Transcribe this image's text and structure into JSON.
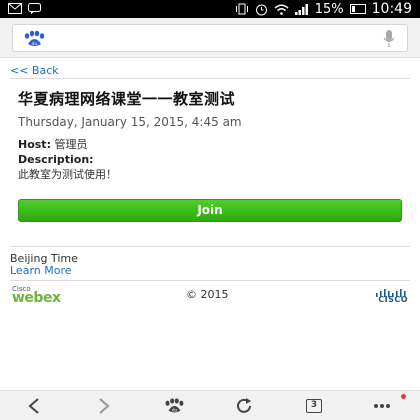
{
  "statusbar": {
    "battery": "15%",
    "time": "10:49"
  },
  "browser": {
    "search_placeholder": ""
  },
  "page": {
    "back_link": "<< Back",
    "title": "华夏病理网络课堂一一教室测试",
    "datetime": "Thursday, January 15, 2015, 4:45 am",
    "host_label": "Host:",
    "host_name": "管理员",
    "description_label": "Description:",
    "description_text": "此教室为测试使用！",
    "join_button": "Join",
    "timezone": "Beijing Time",
    "learn_more": "Learn More"
  },
  "footer": {
    "brand_small": "Cisco",
    "brand": "webex",
    "copyright": "© 2015",
    "cisco_word": "CISCO"
  },
  "navbar": {
    "tab_count": "3"
  },
  "colors": {
    "link": "#1a6fc4",
    "join_green": "#3cbf1c",
    "webex_green": "#6db33f",
    "notification_red": "#e53935"
  }
}
